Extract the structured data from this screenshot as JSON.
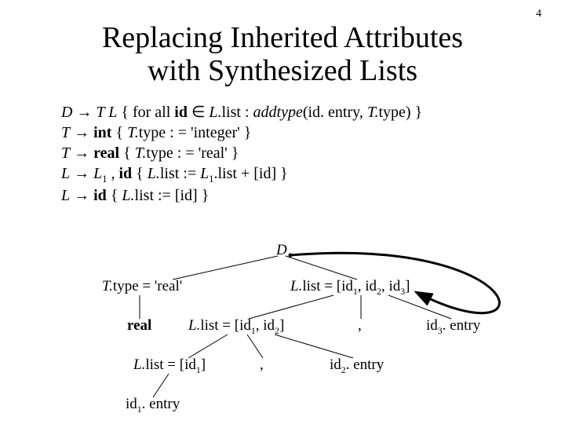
{
  "page_number": "4",
  "title_line1": "Replacing Inherited Attributes",
  "title_line2": "with Synthesized Lists",
  "grammar": {
    "l1_pre": "D",
    "l1_mid": " T L",
    "l1_rest": " { for all ",
    "l1_id": "id",
    "l1_in": " ∈ ",
    "l1_var": "L.",
    "l1_list": "list : ",
    "l1_func": "addtype",
    "l1_args": "(id. entry, ",
    "l1_ttype": "T.",
    "l1_end": "type) }",
    "l2_pre": "T",
    "l2_int": " int",
    "l2_rest": " { ",
    "l2_var": "T.",
    "l2_end": "type : = 'integer' }",
    "l3_pre": "T",
    "l3_real": " real",
    "l3_rest": " { ",
    "l3_var": "T.",
    "l3_end": "type : = 'real' }",
    "l4_pre": "L",
    "l4_l1": " L",
    "l4_comma": " , ",
    "l4_id": "id",
    "l4_rest": " { ",
    "l4_var": "L.",
    "l4_list": "list := ",
    "l4_l1b": "L",
    "l4_listb": ".list + [id] }",
    "l5_pre": "L",
    "l5_id": " id",
    "l5_rest": " { ",
    "l5_var": "L.",
    "l5_end": "list := [id] }"
  },
  "tree": {
    "root": "D",
    "t_annot_pre": "T.",
    "t_annot_rest": "type = 'real'",
    "l_top_pre": "L.",
    "l_top_rest": "list = [id",
    "l_top_c1": ", id",
    "l_top_c2": ", id",
    "l_top_end": "]",
    "real": "real",
    "l_mid_pre": "L.",
    "l_mid_rest": "list = [id",
    "l_mid_c": ", id",
    "l_mid_end": "]",
    "comma1": ",",
    "id3_pre": "id",
    "id3_rest": ". entry",
    "l_bot_pre": "L.",
    "l_bot_rest": "list = [id",
    "l_bot_end": "]",
    "comma2": ",",
    "id2_pre": "id",
    "id2_rest": ". entry",
    "id1_pre": "id",
    "id1_rest": ". entry"
  }
}
